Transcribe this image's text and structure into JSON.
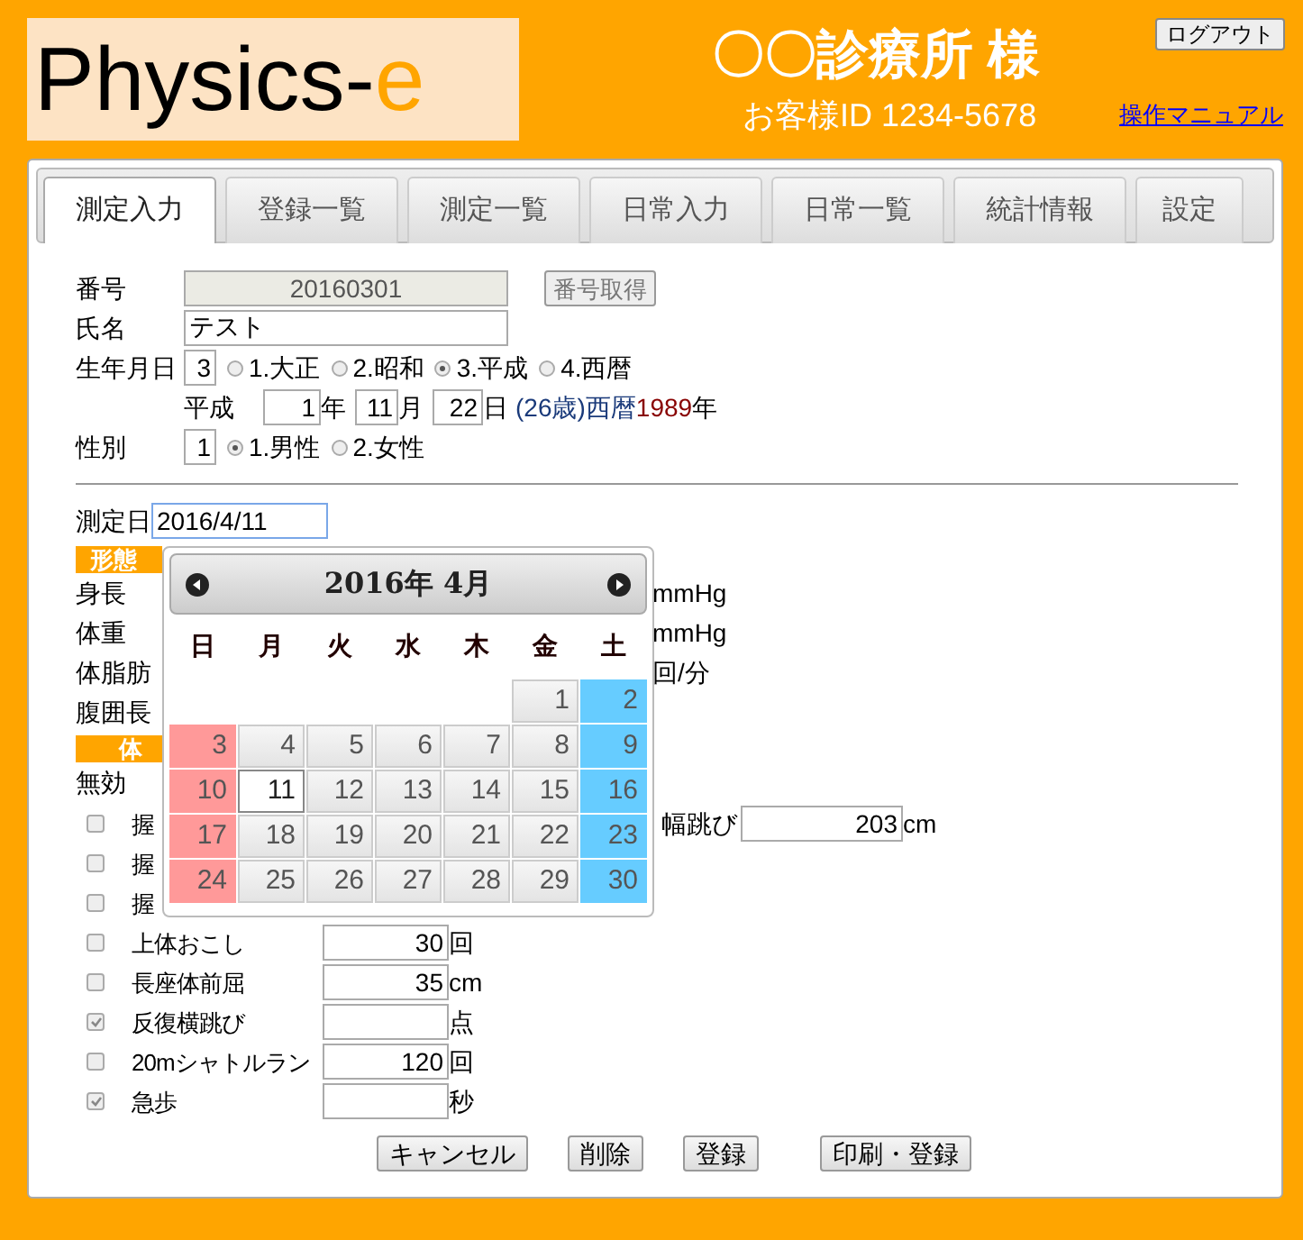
{
  "header": {
    "logo_text": "Physics-",
    "logo_accent": "e",
    "clinic": "〇〇診療所 様",
    "customer_id": "お客様ID 1234-5678",
    "logout_button": "ログアウト",
    "manual_link": "操作マニュアル"
  },
  "tabs": [
    {
      "label": "測定入力",
      "selected": true
    },
    {
      "label": "登録一覧",
      "selected": false
    },
    {
      "label": "測定一覧",
      "selected": false
    },
    {
      "label": "日常入力",
      "selected": false
    },
    {
      "label": "日常一覧",
      "selected": false
    },
    {
      "label": "統計情報",
      "selected": false
    },
    {
      "label": "設定",
      "selected": false
    }
  ],
  "form": {
    "number": {
      "label": "番号",
      "value": "20160301",
      "button": "番号取得"
    },
    "name": {
      "label": "氏名",
      "value": "テスト"
    },
    "birth": {
      "label": "生年月日",
      "era_code": "3",
      "eras": [
        {
          "label": "1.大正",
          "selected": false
        },
        {
          "label": "2.昭和",
          "selected": false
        },
        {
          "label": "3.平成",
          "selected": true
        },
        {
          "label": "4.西暦",
          "selected": false
        }
      ],
      "era_label": "平成",
      "year": "1",
      "year_unit": "年",
      "month": "11",
      "month_unit": "月",
      "day": "22",
      "day_unit": "日",
      "age": "(26歳)西暦",
      "western_year": "1989",
      "western_unit": "年"
    },
    "sex": {
      "label": "性別",
      "code": "1",
      "options": [
        {
          "label": "1.男性",
          "selected": true
        },
        {
          "label": "2.女性",
          "selected": false
        }
      ]
    },
    "measure_date": {
      "label": "測定日",
      "value": "2016/4/11"
    },
    "body_section": {
      "title": "形態",
      "rows": [
        {
          "label": "身長",
          "right_text": "mmHg"
        },
        {
          "label": "体重",
          "right_text": "mmHg"
        },
        {
          "label": "体脂肪",
          "right_text": "回/分"
        },
        {
          "label": "腹囲長"
        }
      ]
    },
    "fitness_section": {
      "title": "体",
      "invalid_label": "無効",
      "items": [
        {
          "kind": "covered",
          "label": "握",
          "checked": false,
          "right_label": "幅跳び",
          "right_value": "203",
          "right_unit": "cm"
        },
        {
          "kind": "covered",
          "label": "握",
          "checked": false
        },
        {
          "kind": "covered-field",
          "label": "握",
          "checked": false
        },
        {
          "kind": "field",
          "label": "上体おこし",
          "checked": false,
          "value": "30",
          "unit": "回"
        },
        {
          "kind": "field",
          "label": "長座体前屈",
          "checked": false,
          "value": "35",
          "unit": "cm"
        },
        {
          "kind": "field",
          "label": "反復横跳び",
          "checked": true,
          "unit": "点"
        },
        {
          "kind": "field",
          "label": "20mシャトルラン",
          "checked": false,
          "value": "120",
          "unit": "回"
        },
        {
          "kind": "field",
          "label": "急歩",
          "checked": true,
          "unit": "秒"
        }
      ]
    },
    "buttons": [
      "キャンセル",
      "削除",
      "登録",
      "印刷・登録"
    ]
  },
  "calendar": {
    "title": "2016年 4月",
    "weekdays": [
      "日",
      "月",
      "火",
      "水",
      "木",
      "金",
      "土"
    ],
    "weeks": [
      [
        {
          "day": "1",
          "selected": false
        },
        {
          "day": "2",
          "selected": false
        }
      ],
      [
        {
          "day": "3",
          "selected": false
        },
        {
          "day": "4",
          "selected": false
        },
        {
          "day": "5",
          "selected": false
        },
        {
          "day": "6",
          "selected": false
        },
        {
          "day": "7",
          "selected": false
        },
        {
          "day": "8",
          "selected": false
        },
        {
          "day": "9",
          "selected": false
        }
      ],
      [
        {
          "day": "10",
          "selected": false
        },
        {
          "day": "11",
          "selected": true
        },
        {
          "day": "12",
          "selected": false
        },
        {
          "day": "13",
          "selected": false
        },
        {
          "day": "14",
          "selected": false
        },
        {
          "day": "15",
          "selected": false
        },
        {
          "day": "16",
          "selected": false
        }
      ],
      [
        {
          "day": "17",
          "selected": false
        },
        {
          "day": "18",
          "selected": false
        },
        {
          "day": "19",
          "selected": false
        },
        {
          "day": "20",
          "selected": false
        },
        {
          "day": "21",
          "selected": false
        },
        {
          "day": "22",
          "selected": false
        },
        {
          "day": "23",
          "selected": false
        }
      ],
      [
        {
          "day": "24",
          "selected": false
        },
        {
          "day": "25",
          "selected": false
        },
        {
          "day": "26",
          "selected": false
        },
        {
          "day": "27",
          "selected": false
        },
        {
          "day": "28",
          "selected": false
        },
        {
          "day": "29",
          "selected": false
        },
        {
          "day": "30",
          "selected": false
        }
      ]
    ]
  }
}
